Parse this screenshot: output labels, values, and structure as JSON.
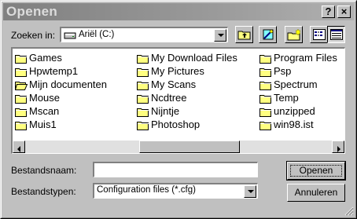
{
  "window": {
    "title": "Openen",
    "help_label": "?",
    "close_label": "×"
  },
  "lookin": {
    "label": "Zoeken in:",
    "value": "Ariël (C:)"
  },
  "files": {
    "columns": [
      [
        "Games",
        "Hpwtemp1",
        "Mijn documenten",
        "Mouse",
        "Mscan",
        "Muis1"
      ],
      [
        "My Download Files",
        "My Pictures",
        "My Scans",
        "Ncdtree",
        "Nijntje",
        "Photoshop"
      ],
      [
        "Program Files",
        "Psp",
        "Spectrum",
        "Temp",
        "unzipped",
        "win98.ist"
      ]
    ]
  },
  "filename": {
    "label": "Bestandsnaam:",
    "value": ""
  },
  "filetype": {
    "label": "Bestandstypen:",
    "value": "Configuration files (*.cfg)"
  },
  "buttons": {
    "open": "Openen",
    "cancel": "Annuleren"
  },
  "colors": {
    "folder": "#ffff80",
    "folder_outline": "#808000"
  }
}
